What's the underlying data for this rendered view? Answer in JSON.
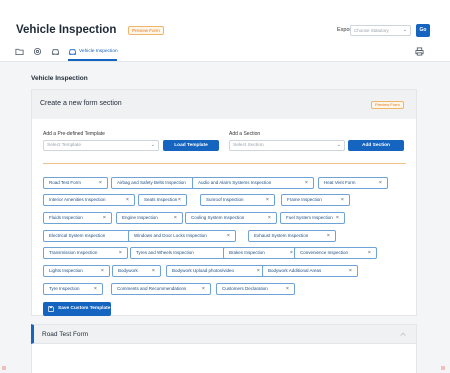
{
  "header": {
    "title": "Vehicle Inspection",
    "preview_badge": "Preview Form",
    "export_label": "Export to:",
    "export_placeholder": "Choose Statutory",
    "go_label": "Go"
  },
  "tabs": {
    "icons": [
      "folder-icon",
      "settings-icon",
      "car-icon"
    ],
    "active_label": "Vehicle Inspection",
    "print_icon": "printer-icon"
  },
  "page_heading": "Vehicle Inspection",
  "form_card": {
    "title": "Create a new form section",
    "preview_badge": "Preview Form",
    "template_label": "Add a Pre-defined Template",
    "template_placeholder": "Select Template",
    "load_button": "Load Template",
    "section_label": "Add a Section",
    "section_placeholder": "Select Section",
    "add_button": "Add Section",
    "chips": [
      "Road Test Form",
      "Airbag and Safety Belts Inspection",
      "Audio and Alarm Systems Inspection",
      "Heat Vent Form",
      "Interior Amenities Inspection",
      "Seats Inspection",
      "Sunroof Inspection",
      "Frame Inspection",
      "Fluids Inspection",
      "Engine Inspection",
      "Cooling System Inspection",
      "Fuel System Inspection",
      "Electrical System Inspection",
      "Windows and Door Locks Inspection",
      "Exhaust System Inspection",
      "Transmission Inspection",
      "Tyres and Wheels Inspection",
      "Brakes Inspection",
      "Convenience Inspection",
      "Lights Inspection",
      "Bodywork",
      "Bodywork Upload photos/video",
      "Bodywork Additional Areas",
      "Tyre Inspection",
      "Comments and Recommendations",
      "Customers Declaration"
    ],
    "save_button": "Save Custom Template"
  },
  "section2": {
    "title": "Road Test Form"
  },
  "colors": {
    "accent": "#1565c0",
    "badge": "#e07b1a",
    "chip_border": "#6fa3d8"
  }
}
